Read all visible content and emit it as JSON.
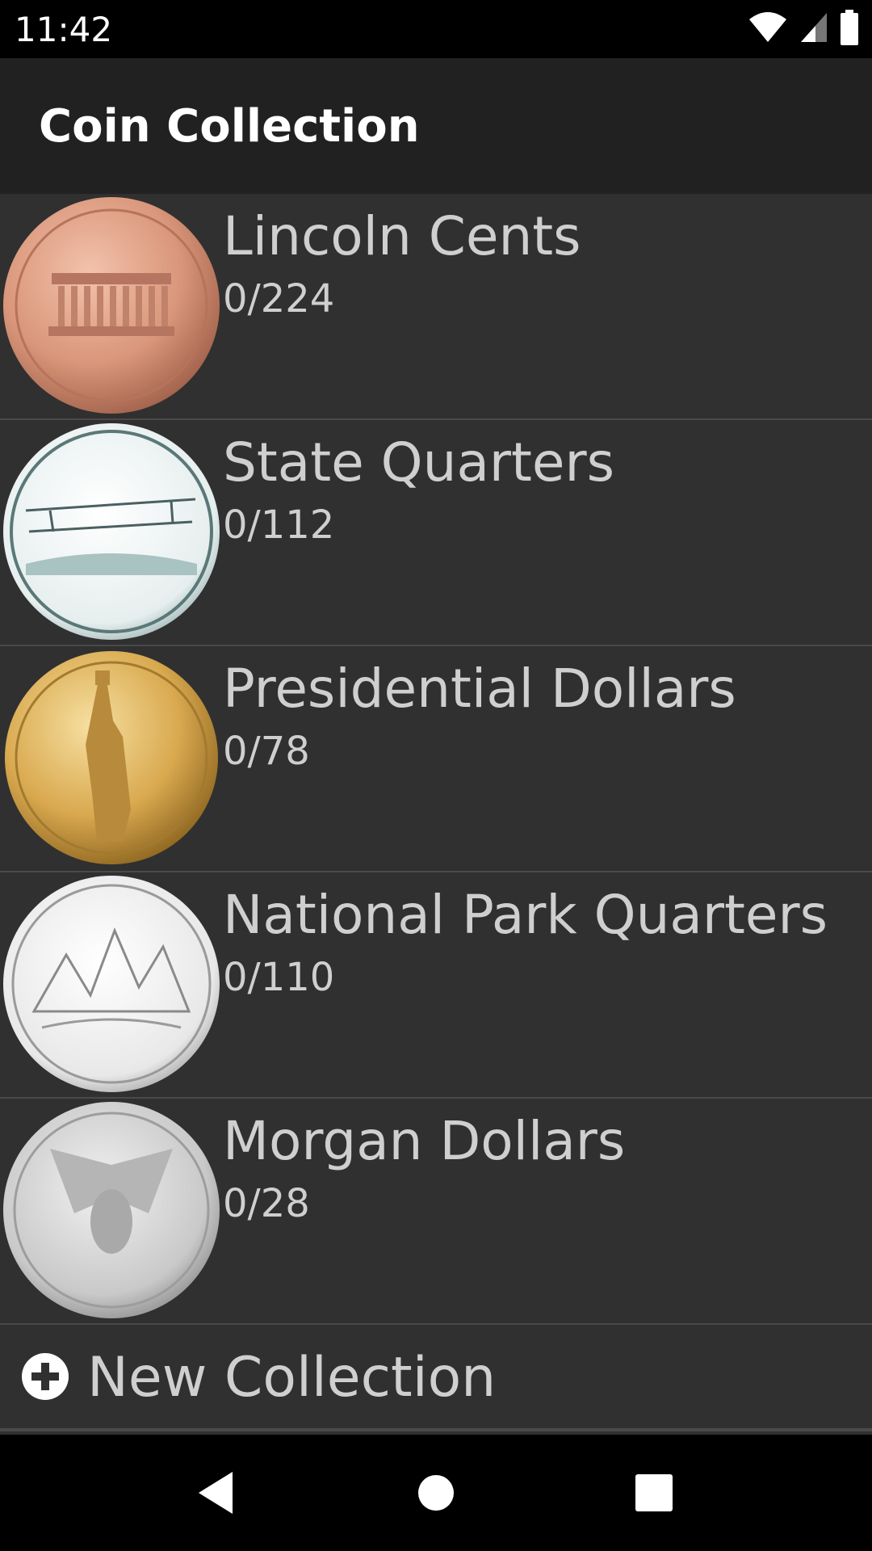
{
  "status_bar": {
    "time": "11:42",
    "icons": [
      "wifi-icon",
      "cell-signal-icon",
      "battery-icon"
    ]
  },
  "app_bar": {
    "title": "Coin Collection"
  },
  "collections": [
    {
      "name": "Lincoln Cents",
      "count": "0/224",
      "coin_color": "#d9967a"
    },
    {
      "name": "State Quarters",
      "count": "0/112",
      "coin_color": "#e6eeee"
    },
    {
      "name": "Presidential Dollars",
      "count": "0/78",
      "coin_color": "#d9a94f"
    },
    {
      "name": "National Park Quarters",
      "count": "0/110",
      "coin_color": "#e8e8e8"
    },
    {
      "name": "Morgan Dollars",
      "count": "0/28",
      "coin_color": "#c9c9c9"
    }
  ],
  "new_collection": {
    "label": "New Collection",
    "icon": "plus-circle-icon"
  },
  "nav_bar": {
    "buttons": [
      "back-icon",
      "home-icon",
      "recents-icon"
    ]
  },
  "colors": {
    "background": "#303030",
    "app_bar": "#212121",
    "text": "#cfcfcf",
    "divider": "#4a4a4a"
  }
}
